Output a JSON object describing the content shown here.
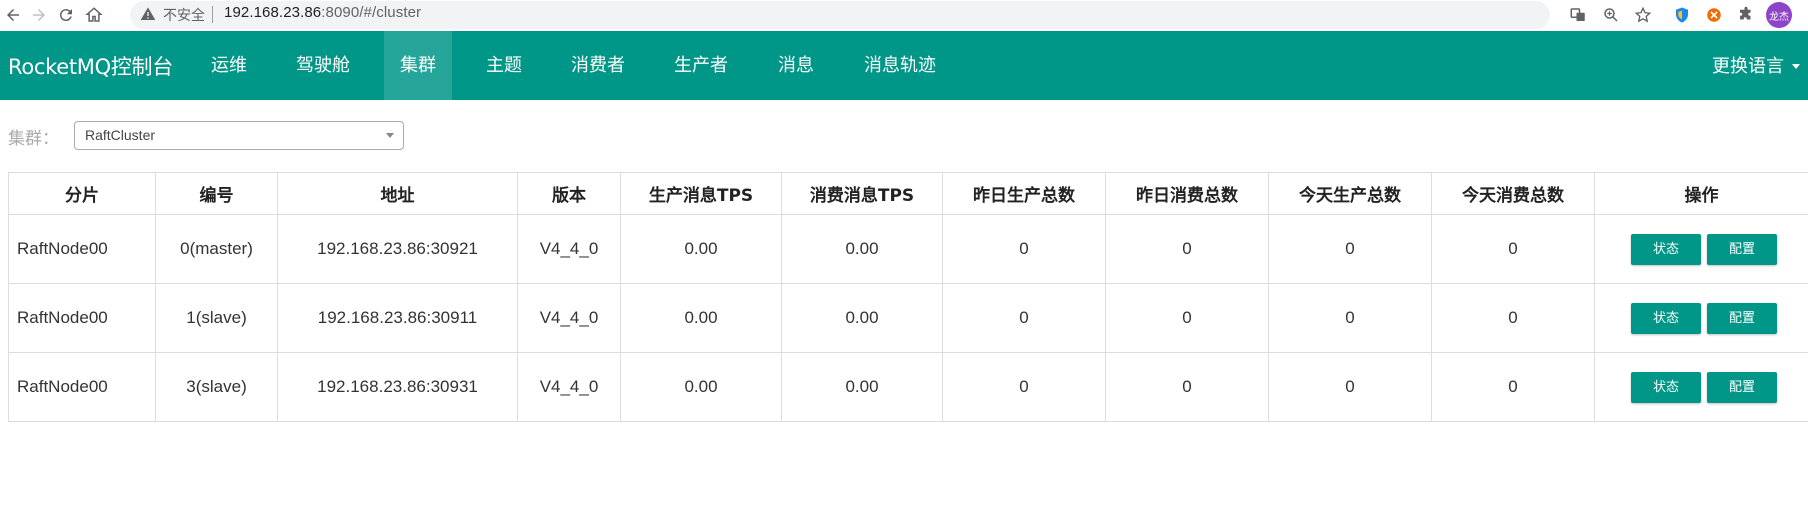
{
  "browser": {
    "insecure_label": "不安全",
    "url_host": "192.168.23.86",
    "url_rest": ":8090/#/cluster"
  },
  "navbar": {
    "brand": "RocketMQ控制台",
    "items": [
      {
        "label": "运维"
      },
      {
        "label": "驾驶舱"
      },
      {
        "label": "集群"
      },
      {
        "label": "主题"
      },
      {
        "label": "消费者"
      },
      {
        "label": "生产者"
      },
      {
        "label": "消息"
      },
      {
        "label": "消息轨迹"
      }
    ],
    "active_item": "集群",
    "language": "更换语言"
  },
  "cluster_filter": {
    "label": "集群：",
    "selected": "RaftCluster"
  },
  "table": {
    "headers": [
      "分片",
      "编号",
      "地址",
      "版本",
      "生产消息TPS",
      "消费消息TPS",
      "昨日生产总数",
      "昨日消费总数",
      "今天生产总数",
      "今天消费总数",
      "操作"
    ],
    "rows": [
      {
        "shard": "RaftNode00",
        "id": "0(master)",
        "address": "192.168.23.86:30921",
        "version": "V4_4_0",
        "produce_tps": "0.00",
        "consume_tps": "0.00",
        "yesterday_produce": "0",
        "yesterday_consume": "0",
        "today_produce": "0",
        "today_consume": "0"
      },
      {
        "shard": "RaftNode00",
        "id": "1(slave)",
        "address": "192.168.23.86:30911",
        "version": "V4_4_0",
        "produce_tps": "0.00",
        "consume_tps": "0.00",
        "yesterday_produce": "0",
        "yesterday_consume": "0",
        "today_produce": "0",
        "today_consume": "0"
      },
      {
        "shard": "RaftNode00",
        "id": "3(slave)",
        "address": "192.168.23.86:30931",
        "version": "V4_4_0",
        "produce_tps": "0.00",
        "consume_tps": "0.00",
        "yesterday_produce": "0",
        "yesterday_consume": "0",
        "today_produce": "0",
        "today_consume": "0"
      }
    ],
    "status_button": "状态",
    "config_button": "配置"
  },
  "colors": {
    "primary": "#009688",
    "active_nav": "#26a69a"
  },
  "avatar_text": "龙杰"
}
